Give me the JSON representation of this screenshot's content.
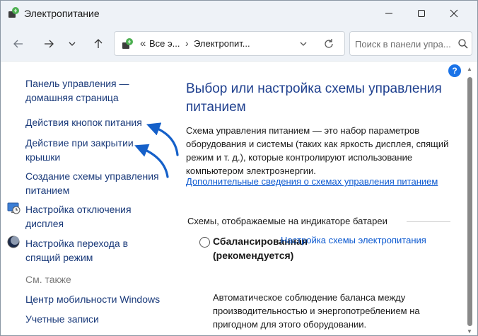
{
  "window": {
    "title": "Электропитание"
  },
  "nav": {
    "breadcrumb": [
      "Все э...",
      "Электропит..."
    ],
    "search_placeholder": "Поиск в панели упра..."
  },
  "sidebar": {
    "links": [
      "Панель управления — домашняя страница",
      "Действия кнопок питания",
      "Действие при закрытии крышки",
      "Создание схемы управления питанием",
      "Настройка отключения дисплея",
      "Настройка перехода в спящий режим"
    ],
    "see_also_label": "См. также",
    "see_also": [
      "Центр мобильности Windows",
      "Учетные записи"
    ]
  },
  "main": {
    "title": "Выбор или настройка схемы управления питанием",
    "description": "Схема управления питанием — это набор параметров оборудования и системы (таких как яркость дисплея, спящий режим и т. д.), которые контролируют использование компьютером электроэнергии.",
    "more_link": "Дополнительные сведения о схемах управления питанием",
    "section_title": "Схемы, отображаемые на индикаторе батареи",
    "plan": {
      "name": "Сбалансированная (рекомендуется)",
      "settings_link": "Настройка схемы электропитания",
      "description": "Автоматическое соблюдение баланса между производительностью и энергопотреблением на пригодном для этого оборудовании."
    }
  },
  "colors": {
    "link": "#1a3a7a",
    "accent": "#1e3f8e",
    "arrow": "#1560c9"
  },
  "icons": [
    "power-options-icon",
    "minimize-icon",
    "maximize-icon",
    "close-icon",
    "back-arrow-icon",
    "forward-arrow-icon",
    "chevron-down-icon",
    "up-arrow-icon",
    "refresh-icon",
    "search-icon",
    "help-icon",
    "display-clock-icon",
    "moon-icon"
  ]
}
